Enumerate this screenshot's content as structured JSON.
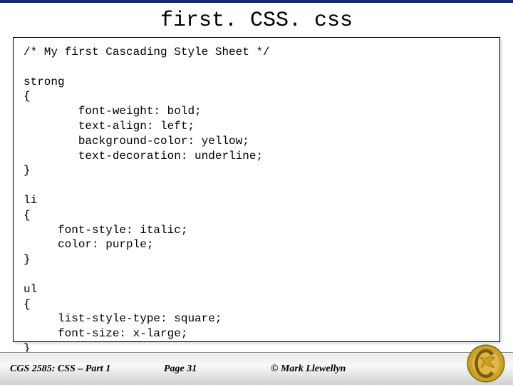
{
  "title": "first. CSS. css",
  "code": "/* My first Cascading Style Sheet */\n\nstrong\n{\n        font-weight: bold;\n        text-align: left;\n        background-color: yellow;\n        text-decoration: underline;\n}\n\nli\n{\n     font-style: italic;\n     color: purple;\n}\n\nul\n{\n     list-style-type: square;\n     font-size: x-large;\n}",
  "footer": {
    "course": "CGS 2585: CSS – Part 1",
    "page": "Page 31",
    "copyright": "© Mark Llewellyn"
  }
}
